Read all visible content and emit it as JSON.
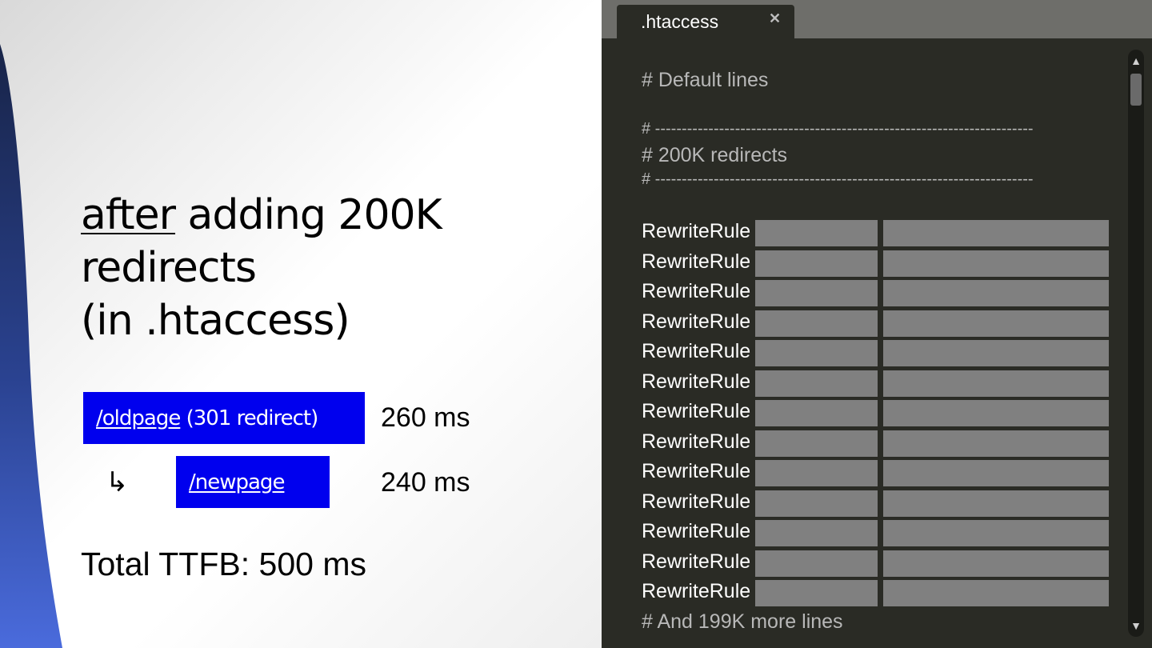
{
  "slide": {
    "headline_underlined": "after",
    "headline_rest": " adding 200K",
    "headline_line2": "redirects",
    "headline_line3": "(in .htaccess)",
    "old_link": "/oldpage",
    "old_suffix": " (301 redirect)",
    "old_time": "260 ms",
    "redirect_arrow": "↳",
    "new_link": "/newpage",
    "new_time": "240 ms",
    "total": "Total TTFB: 500 ms"
  },
  "editor": {
    "tab_title": ".htaccess",
    "tab_close_icon": "close-icon",
    "comment_default": "# Default lines",
    "divider_line": "# -----------------------------------------------------------------------",
    "comment_section": "# 200K redirects",
    "rule_keyword": "RewriteRule",
    "rule_count_visible": 13,
    "comment_more": "# And 199K more lines",
    "scroll_up_icon": "▲",
    "scroll_down_icon": "▼"
  },
  "colors": {
    "link_box": "#0000ee",
    "editor_bg": "#2a2b25",
    "tabbar_bg": "#6e6e6a",
    "redacted_block": "#808080",
    "comment_text": "#b8b8b8"
  }
}
